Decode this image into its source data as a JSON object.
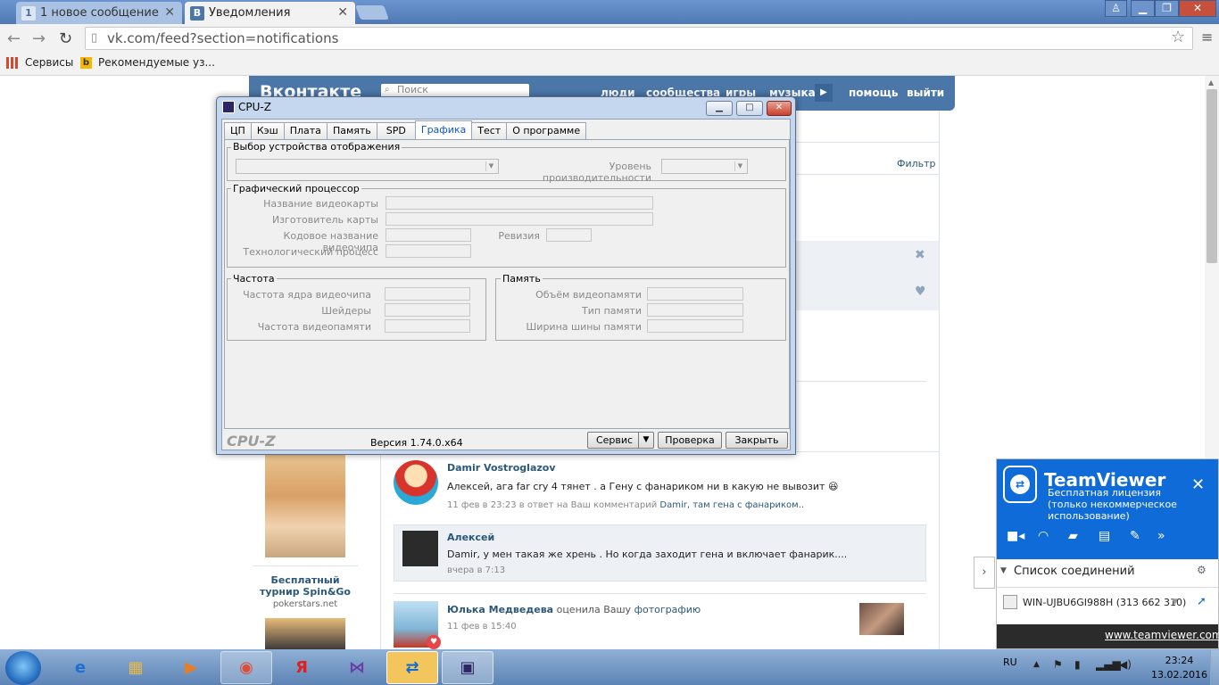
{
  "browser": {
    "tabs": [
      {
        "label": "1 новое сообщение",
        "favicon": "1"
      },
      {
        "label": "Уведомления",
        "favicon": "В"
      }
    ],
    "url": "vk.com/feed?section=notifications",
    "bookmarks": [
      {
        "label": "Сервисы",
        "icon": "apps-grid-icon"
      },
      {
        "label": "Рекомендуемые уз...",
        "icon": "bing-icon"
      }
    ]
  },
  "vk": {
    "logo": "Вконтакте",
    "search_placeholder": "Поиск",
    "nav": [
      "люди",
      "сообщества",
      "игры",
      "музыка",
      "помощь",
      "выйти"
    ],
    "filter_label": "Фильтр",
    "ad": {
      "title": "Бесплатный турнир Spin&Go",
      "site": "pokerstars.net"
    },
    "posts": [
      {
        "name": "Damir Vostroglazov",
        "text": "Алексей, ага far cry 4 тянет . а Гену с фанариком ни в какую не вывозит",
        "emoji": "😆",
        "meta_prefix": "11 фев в 23:23 в ответ на Ваш комментарий",
        "meta_link": "Damir, там гена с фанариком.."
      },
      {
        "name": "Алексей",
        "text": "Damir, у мен такая же хрень . Но когда заходит гена и включает фанарик....",
        "meta": "вчера в 7:13"
      },
      {
        "name": "Юлька Медведева",
        "action": "оценила Вашу",
        "action_link": "фотографию",
        "meta": "11 фев в 15:40"
      }
    ]
  },
  "cpuz": {
    "title": "CPU-Z",
    "tabs": [
      "ЦП",
      "Кэш",
      "Плата",
      "Память",
      "SPD",
      "Графика",
      "Тест",
      "О программе"
    ],
    "active_tab": "Графика",
    "display_group": "Выбор устройства отображения",
    "perf_label": "Уровень производительности",
    "gpu_group": "Графический процессор",
    "gpu_labels": [
      "Название видеокарты",
      "Изготовитель карты",
      "Кодовое название видеочипа",
      "Технологический процесс"
    ],
    "revision_label": "Ревизия",
    "freq_group": "Частота",
    "freq_labels": [
      "Частота ядра видеочипа",
      "Шейдеры",
      "Частота видеопамяти"
    ],
    "mem_group": "Память",
    "mem_labels": [
      "Объём видеопамяти",
      "Тип памяти",
      "Ширина шины памяти"
    ],
    "logo": "CPU-Z",
    "version": "Версия 1.74.0.x64",
    "buttons": {
      "service": "Сервис",
      "check": "Проверка",
      "close": "Закрыть"
    }
  },
  "teamviewer": {
    "name": "TeamViewer",
    "subtitle": "Бесплатная лицензия (только некоммерческое использование)",
    "icons": [
      "video-icon",
      "headset-icon",
      "chat-icon",
      "files-icon",
      "tools-icon",
      "more-icon"
    ],
    "list_title": "Список соединений",
    "computer": "WIN-UJBU6GI988H (313 662 310)",
    "url": "www.teamviewer.com"
  },
  "taskbar": {
    "apps": [
      "ie-icon",
      "explorer-icon",
      "media-player-icon",
      "chrome-icon",
      "yandex-icon",
      "visual-studio-icon",
      "teamviewer-icon",
      "cpuz-icon"
    ],
    "lang": "RU",
    "time": "23:24",
    "date": "13.02.2016"
  },
  "colors": {
    "vk_blue": "#4a76a8",
    "tv_blue": "#0e6bd8",
    "cpuz_active_tab": "#0a58c8"
  }
}
